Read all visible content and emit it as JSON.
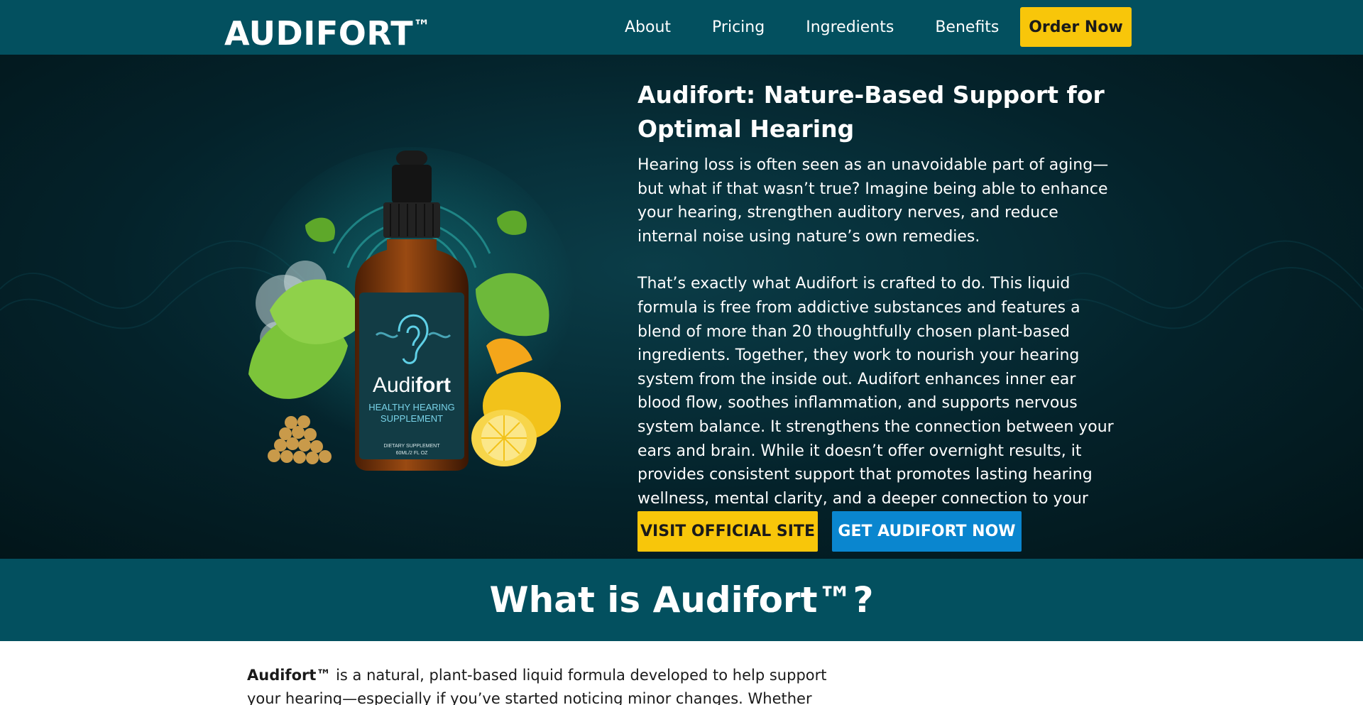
{
  "nav": {
    "brand": "AUDIFORT",
    "brand_tm": "™",
    "links": [
      "About",
      "Pricing",
      "Ingredients",
      "Benefits"
    ],
    "cta": "Order Now"
  },
  "hero": {
    "title": "Audifort: Nature-Based Support for Optimal Hearing",
    "paragraph1": "Hearing loss is often seen as an unavoidable part of aging—but what if that wasn’t true? Imagine being able to enhance your hearing, strengthen auditory nerves, and reduce internal noise using nature’s own remedies.",
    "paragraph2": "That’s exactly what Audifort is crafted to do. This liquid formula is free from addictive substances and features a blend of more than 20 thoughtfully chosen plant-based ingredients. Together, they work to nourish your hearing system from the inside out. Audifort enhances inner ear blood flow, soothes inflammation, and supports nervous system balance. It strengthens the connection between your ears and brain. While it doesn’t offer overnight results, it provides consistent support that promotes lasting hearing wellness, mental clarity, and a deeper connection to your surroundings.",
    "btn_primary": "VISIT OFFICIAL SITE",
    "btn_secondary": "GET AUDIFORT NOW",
    "product": {
      "brand_a": "Audi",
      "brand_b": "fort",
      "line1": "HEALTHY HEARING",
      "line2": "SUPPLEMENT",
      "small1": "DIETARY SUPPLEMENT",
      "small2": "60ML/2 FL OZ"
    }
  },
  "section": {
    "title": "What is Audifort™?"
  },
  "content": {
    "lead_bold": "Audifort™",
    "lead_text": " is a natural, plant-based liquid formula developed to help support your hearing—especially if you’ve started noticing minor changes. Whether"
  },
  "colors": {
    "nav_bg": "#03505f",
    "accent_yellow": "#f8c60a",
    "accent_blue": "#0a86cf"
  }
}
